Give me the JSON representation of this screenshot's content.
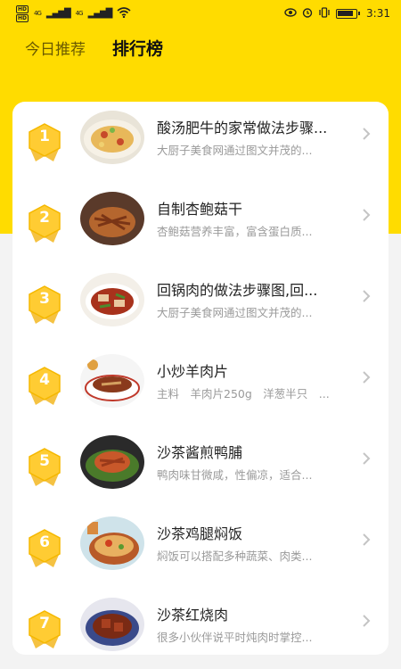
{
  "status_bar": {
    "hd1": "HD",
    "hd2": "HD",
    "net1": "4G",
    "net2": "4G",
    "time": "3:31"
  },
  "tabs": [
    {
      "label": "今日推荐",
      "active": false
    },
    {
      "label": "排行榜",
      "active": true
    }
  ],
  "items": [
    {
      "rank": "1",
      "title": "酸汤肥牛的家常做法步骤...",
      "desc": "大厨子美食网通过图文并茂的..."
    },
    {
      "rank": "2",
      "title": "自制杏鲍菇干",
      "desc": "杏鲍菇营养丰富，富含蛋白质..."
    },
    {
      "rank": "3",
      "title": "回锅肉的做法步骤图,回...",
      "desc": "大厨子美食网通过图文并茂的..."
    },
    {
      "rank": "4",
      "title": "小炒羊肉片",
      "desc": "主料　羊肉片250g　洋葱半只　..."
    },
    {
      "rank": "5",
      "title": "沙茶酱煎鸭脯",
      "desc": "鸭肉味甘微咸，性偏凉，适合..."
    },
    {
      "rank": "6",
      "title": "沙茶鸡腿焖饭",
      "desc": "焖饭可以搭配多种蔬菜、肉类..."
    },
    {
      "rank": "7",
      "title": "沙茶红烧肉",
      "desc": "很多小伙伴说平时炖肉时掌控..."
    }
  ],
  "colors": {
    "accent": "#ffdc00",
    "badge": "#ffcc33"
  }
}
